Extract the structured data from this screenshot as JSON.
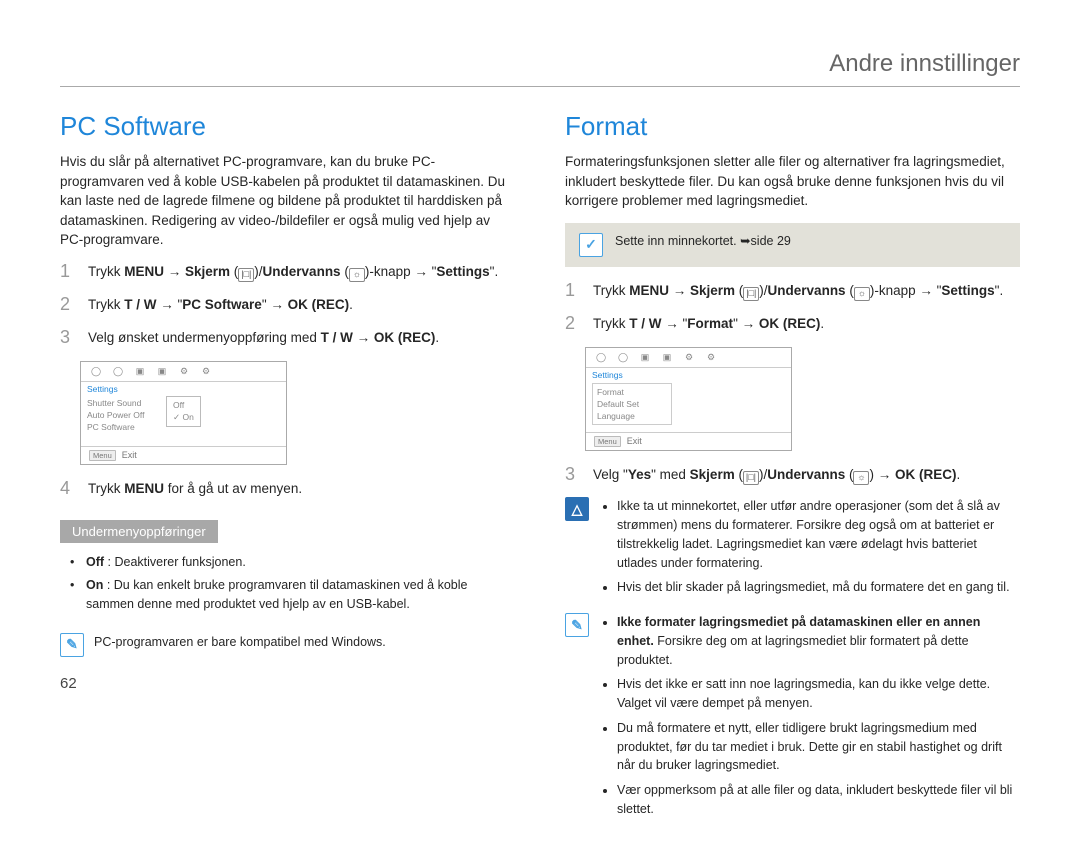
{
  "header": "Andre innstillinger",
  "page_number": "62",
  "left": {
    "title": "PC Software",
    "intro": "Hvis du slår på alternativet PC-programvare, kan du bruke PC-programvaren ved å koble USB-kabelen på produktet til datamaskinen. Du kan laste ned de lagrede filmene og bildene på produktet til harddisken på datamaskinen. Redigering av video-/bildefiler er også mulig ved hjelp av PC-programvare.",
    "step1_a": "Trykk ",
    "step1_menu": "MENU",
    "step1_b": " → ",
    "step1_skjerm": "Skjerm",
    "step1_c": " (",
    "step1_d": ")/",
    "step1_under": "Undervanns",
    "step1_e": " (",
    "step1_f": ")-knapp → \"",
    "step1_settings": "Settings",
    "step1_g": "\".",
    "step2_a": "Trykk ",
    "step2_tw": "T / W",
    "step2_b": " → \"",
    "step2_pc": "PC Software",
    "step2_c": "\" → ",
    "step2_ok": "OK (REC)",
    "step2_d": ".",
    "step3_a": "Velg ønsket undermenyoppføring med ",
    "step3_tw": "T / W",
    "step3_b": " → ",
    "step3_ok": "OK (REC)",
    "step3_c": ".",
    "thumb": {
      "header": "Settings",
      "rows": [
        "Shutter Sound",
        "Auto Power Off",
        "PC Software"
      ],
      "popup": [
        "Off",
        "✓ On"
      ],
      "exit": "Exit",
      "menu": "Menu"
    },
    "step4_a": "Trykk ",
    "step4_menu": "MENU",
    "step4_b": " for å gå ut av menyen.",
    "sub_header": "Undermenyoppføringer",
    "sub_off_label": "Off",
    "sub_off_text": " : Deaktiverer funksjonen.",
    "sub_on_label": "On",
    "sub_on_text": " : Du kan enkelt bruke programvaren til datamaskinen ved å koble sammen denne med produktet ved hjelp av en USB-kabel.",
    "note": "PC-programvaren er bare kompatibel med Windows."
  },
  "right": {
    "title": "Format",
    "intro": "Formateringsfunksjonen sletter alle filer og alternativer fra lagringsmediet, inkludert beskyttede filer. Du kan også bruke denne funksjonen hvis du vil korrigere problemer med lagringsmediet.",
    "callout": "Sette inn minnekortet. ➥side 29",
    "step1_a": "Trykk ",
    "step1_menu": "MENU",
    "step1_b": " → ",
    "step1_skjerm": "Skjerm",
    "step1_c": " (",
    "step1_d": ")/",
    "step1_under": "Undervanns",
    "step1_e": " (",
    "step1_f": ")-knapp → \"",
    "step1_settings": "Settings",
    "step1_g": "\".",
    "step2_a": "Trykk ",
    "step2_tw": "T / W",
    "step2_b": " → \"",
    "step2_fmt": "Format",
    "step2_c": "\" → ",
    "step2_ok": "OK (REC)",
    "step2_d": ".",
    "thumb": {
      "header": "Settings",
      "rows": [
        "Format",
        "Default Set",
        "Language"
      ],
      "exit": "Exit",
      "menu": "Menu"
    },
    "step3_a": "Velg \"",
    "step3_yes": "Yes",
    "step3_b": "\" med ",
    "step3_skjerm": "Skjerm",
    "step3_c": " (",
    "step3_d": ")/",
    "step3_under": "Undervanns",
    "step3_e": " (",
    "step3_f": ") → ",
    "step3_ok": "OK (REC)",
    "step3_g": ".",
    "warn1": "Ikke ta ut minnekortet, eller utfør andre operasjoner (som det å slå av strømmen) mens du formaterer. Forsikre deg også om at batteriet er tilstrekkelig ladet. Lagringsmediet kan være ødelagt hvis batteriet utlades under formatering.",
    "warn2": "Hvis det blir skader på lagringsmediet, må du formatere det en gang til.",
    "note_b1": "Ikke formater lagringsmediet på datamaskinen eller en annen enhet.",
    "note_b1_rest": " Forsikre deg om at lagringsmediet blir formatert på dette produktet.",
    "note_b2": "Hvis det ikke er satt inn noe lagringsmedia, kan du ikke velge dette. Valget vil være dempet på menyen.",
    "note_b3": "Du må formatere et nytt, eller tidligere brukt lagringsmedium med produktet, før du tar mediet i bruk. Dette gir en stabil hastighet og drift når du bruker lagringsmediet.",
    "note_b4": "Vær oppmerksom på at alle filer og data, inkludert beskyttede filer vil bli slettet."
  }
}
